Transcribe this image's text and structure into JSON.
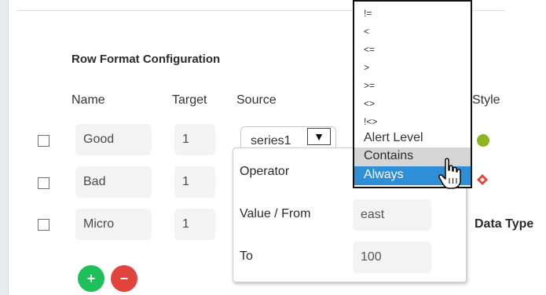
{
  "section": {
    "title": "Row Format Configuration"
  },
  "columns": {
    "name": "Name",
    "target": "Target",
    "source": "Source",
    "style": "Style"
  },
  "rows": [
    {
      "name": "Good",
      "target": "1"
    },
    {
      "name": "Bad",
      "target": "1"
    },
    {
      "name": "Micro",
      "target": "1"
    }
  ],
  "source_select": {
    "value": "series1",
    "arrow": "▼"
  },
  "popover": {
    "operator_label": "Operator",
    "value_label": "Value / From",
    "value": "east",
    "to_label": "To",
    "to_value": "100"
  },
  "operator_options": [
    "!=",
    "<",
    "<=",
    ">",
    ">=",
    "<>",
    "!<>"
  ],
  "operator_options_large": {
    "alert": "Alert Level",
    "contains": "Contains",
    "always": "Always"
  },
  "data_type_label": "Data Type",
  "buttons": {
    "add": "+",
    "remove": "−"
  },
  "colors": {
    "add_button": "#1fbf5a",
    "remove_button": "#e0443a",
    "selected_option": "#2f8fd6",
    "hover_option": "#d5d5d5",
    "style_good": "#8db520",
    "style_bad": "#e0443a"
  }
}
